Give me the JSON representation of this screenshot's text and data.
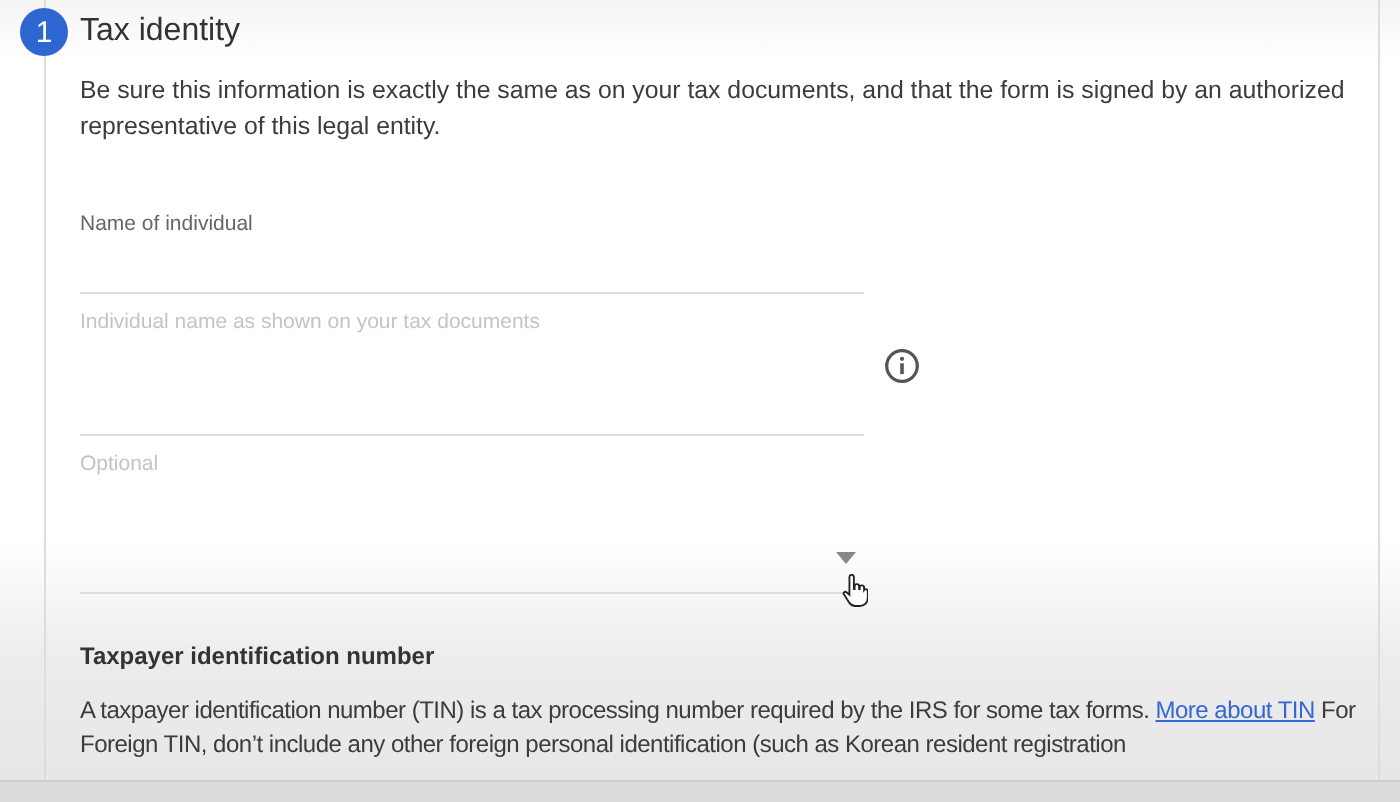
{
  "section": {
    "step": "1",
    "title": "Tax identity",
    "description": "Be sure this information is exactly the same as on your tax documents, and that the form is signed by an authorized representative of this legal entity."
  },
  "fields": [
    {
      "kind": "text",
      "label": "Name of individual"
    },
    {
      "kind": "text",
      "placeholder": "Individual name as shown on your tax documents",
      "info": true
    },
    {
      "kind": "select",
      "placeholder": "Optional"
    }
  ],
  "tin": {
    "heading": "Taxpayer identification number",
    "text_before": "A taxpayer identification number (TIN) is a tax processing number required by the IRS for some tax forms.",
    "link": "More about TIN",
    "text_after": "For Foreign TIN, don’t include any other foreign personal identification (such as Korean resident registration"
  }
}
